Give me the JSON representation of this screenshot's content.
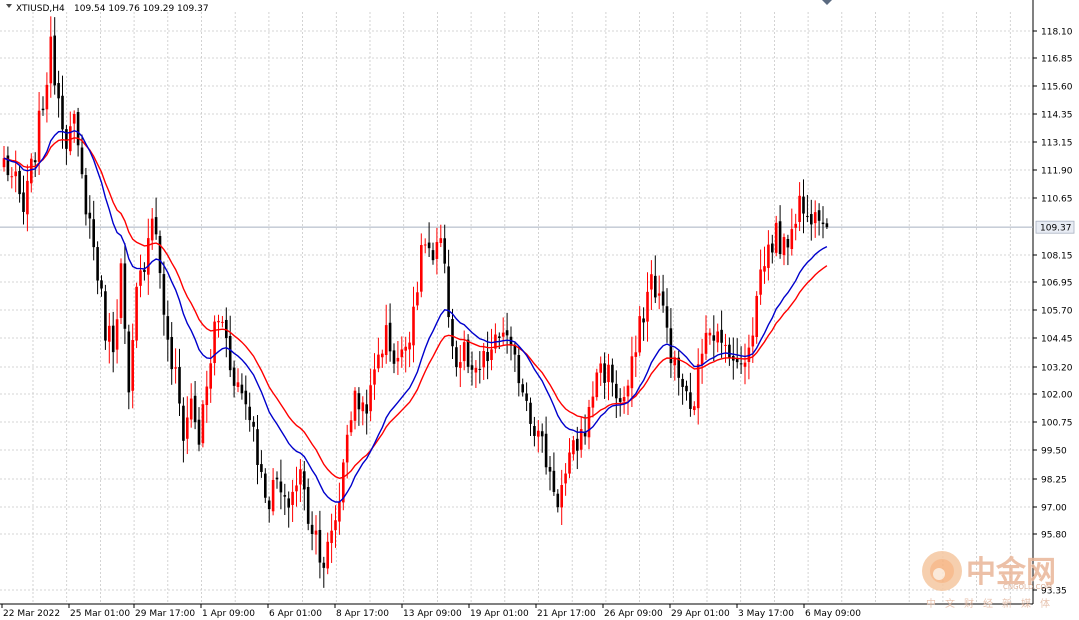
{
  "chart_data": {
    "type": "candlestick",
    "symbol_header": "XTIUSD,H4",
    "ohlc_header": "109.54 109.76 109.29 109.37",
    "current_price": 109.37,
    "current_price_label": "109.37",
    "ylim": [
      93.35,
      119.0
    ],
    "y_ticks": [
      "118.10",
      "116.85",
      "115.60",
      "114.35",
      "113.15",
      "111.90",
      "110.65",
      "108.15",
      "106.95",
      "105.70",
      "104.45",
      "103.20",
      "102.00",
      "100.75",
      "99.50",
      "98.25",
      "97.00",
      "95.80",
      "93.35"
    ],
    "x_ticks": [
      "22 Mar 2022",
      "25 Mar 01:00",
      "29 Mar 17:00",
      "1 Apr 09:00",
      "6 Apr 01:00",
      "8 Apr 17:00",
      "13 Apr 09:00",
      "19 Apr 01:00",
      "21 Apr 17:00",
      "26 Apr 09:00",
      "29 Apr 01:00",
      "3 May 17:00",
      "6 May 09:00"
    ],
    "grid": true,
    "legend": "none",
    "colors": {
      "bull": "#ff0000",
      "bear": "#000000",
      "ma_fast": "#0000cc",
      "ma_slow": "#ff0000",
      "price_line": "#a8b0c0",
      "grid": "#c8c8c8"
    },
    "close_anchors": [
      [
        0,
        112.3
      ],
      [
        3,
        111.2
      ],
      [
        5,
        110.0
      ],
      [
        8,
        112.8
      ],
      [
        10,
        114.9
      ],
      [
        12,
        117.2
      ],
      [
        14,
        115.2
      ],
      [
        16,
        113.4
      ],
      [
        18,
        113.8
      ],
      [
        20,
        111.4
      ],
      [
        22,
        109.6
      ],
      [
        24,
        107.4
      ],
      [
        26,
        104.9
      ],
      [
        28,
        104.3
      ],
      [
        30,
        107.5
      ],
      [
        32,
        101.6
      ],
      [
        34,
        106.3
      ],
      [
        36,
        108.0
      ],
      [
        38,
        110.2
      ],
      [
        40,
        107.5
      ],
      [
        42,
        104.0
      ],
      [
        44,
        102.7
      ],
      [
        46,
        100.3
      ],
      [
        48,
        101.7
      ],
      [
        50,
        100.0
      ],
      [
        52,
        102.2
      ],
      [
        54,
        104.9
      ],
      [
        56,
        105.3
      ],
      [
        58,
        103.4
      ],
      [
        60,
        102.4
      ],
      [
        62,
        101.6
      ],
      [
        64,
        100.6
      ],
      [
        66,
        98.2
      ],
      [
        68,
        97.4
      ],
      [
        70,
        98.1
      ],
      [
        72,
        96.9
      ],
      [
        74,
        97.7
      ],
      [
        76,
        98.5
      ],
      [
        78,
        96.6
      ],
      [
        80,
        95.8
      ],
      [
        82,
        94.6
      ],
      [
        84,
        95.6
      ],
      [
        86,
        97.4
      ],
      [
        88,
        100.5
      ],
      [
        90,
        101.7
      ],
      [
        92,
        101.5
      ],
      [
        94,
        101.9
      ],
      [
        96,
        103.8
      ],
      [
        98,
        104.6
      ],
      [
        100,
        103.7
      ],
      [
        102,
        103.6
      ],
      [
        104,
        104.9
      ],
      [
        106,
        107.0
      ],
      [
        108,
        108.9
      ],
      [
        110,
        107.8
      ],
      [
        112,
        108.6
      ],
      [
        114,
        105.7
      ],
      [
        116,
        103.2
      ],
      [
        118,
        103.9
      ],
      [
        120,
        102.5
      ],
      [
        122,
        103.1
      ],
      [
        124,
        103.6
      ],
      [
        126,
        104.1
      ],
      [
        128,
        104.9
      ],
      [
        130,
        103.6
      ],
      [
        132,
        102.9
      ],
      [
        134,
        101.9
      ],
      [
        136,
        100.6
      ],
      [
        138,
        99.7
      ],
      [
        140,
        98.5
      ],
      [
        142,
        97.4
      ],
      [
        144,
        98.3
      ],
      [
        146,
        99.4
      ],
      [
        148,
        100.2
      ],
      [
        150,
        101.0
      ],
      [
        152,
        103.2
      ],
      [
        154,
        103.0
      ],
      [
        156,
        102.7
      ],
      [
        158,
        101.5
      ],
      [
        160,
        102.3
      ],
      [
        162,
        103.9
      ],
      [
        164,
        105.7
      ],
      [
        166,
        107.1
      ],
      [
        168,
        106.3
      ],
      [
        170,
        104.8
      ],
      [
        172,
        103.1
      ],
      [
        174,
        102.4
      ],
      [
        176,
        101.0
      ],
      [
        178,
        102.8
      ],
      [
        180,
        105.2
      ],
      [
        182,
        104.9
      ],
      [
        184,
        103.9
      ],
      [
        186,
        104.2
      ],
      [
        188,
        103.0
      ],
      [
        190,
        103.8
      ],
      [
        192,
        105.0
      ],
      [
        194,
        107.4
      ],
      [
        196,
        108.4
      ],
      [
        198,
        109.1
      ],
      [
        200,
        108.3
      ],
      [
        202,
        109.6
      ],
      [
        204,
        110.5
      ],
      [
        206,
        109.6
      ],
      [
        208,
        110.6
      ],
      [
        210,
        110.0
      ],
      [
        211,
        109.37
      ]
    ]
  }
}
